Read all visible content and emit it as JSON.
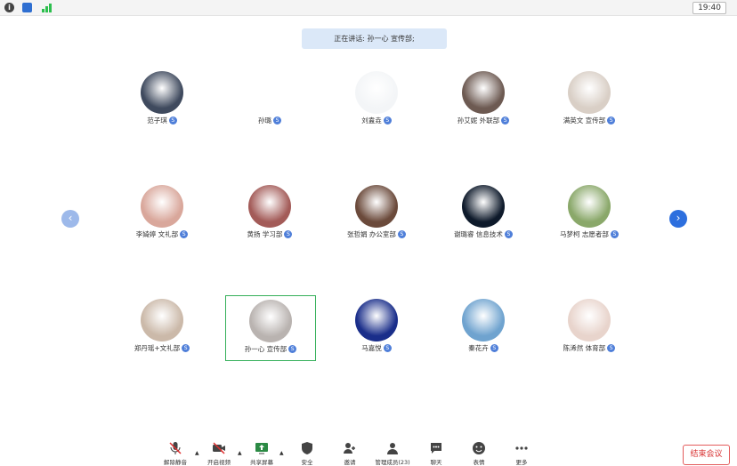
{
  "status_bar": {
    "time": "19:40"
  },
  "speaker_banner": {
    "label": "正在讲话: 孙一心 宣传部;"
  },
  "participants": [
    {
      "name": "范子琪",
      "badge": "S",
      "active": false,
      "avatar_color": "#3f4a5e"
    },
    {
      "name": "孙璐",
      "badge": "S",
      "active": false,
      "avatar_color": "#ffffff"
    },
    {
      "name": "刘盍垚",
      "badge": "S",
      "active": false,
      "avatar_color": "#f3f5f7"
    },
    {
      "name": "孙艾妮 外联部",
      "badge": "S",
      "active": false,
      "avatar_color": "#6d5a52"
    },
    {
      "name": "满英文 宣传部",
      "badge": "S",
      "active": false,
      "avatar_color": "#d9cfc6"
    },
    {
      "name": "李婍婷 文礼部",
      "badge": "S",
      "active": false,
      "avatar_color": "#d9a79b"
    },
    {
      "name": "黄扬 学习部",
      "badge": "S",
      "active": false,
      "avatar_color": "#a35b58"
    },
    {
      "name": "张哲娟 办公室部",
      "badge": "S",
      "active": false,
      "avatar_color": "#6b4a3b"
    },
    {
      "name": "谢璐睿 信息技术",
      "badge": "S",
      "active": false,
      "avatar_color": "#0e1a2b"
    },
    {
      "name": "马梦柯 志愿者部",
      "badge": "S",
      "active": false,
      "avatar_color": "#8aa86a"
    },
    {
      "name": "郑丹瑶+文礼部",
      "badge": "S",
      "active": false,
      "avatar_color": "#cbb9a9"
    },
    {
      "name": "孙一心 宣传部",
      "badge": "S",
      "active": true,
      "avatar_color": "#b9b3b0"
    },
    {
      "name": "马嘉悦",
      "badge": "S",
      "active": false,
      "avatar_color": "#1a2e8a"
    },
    {
      "name": "秦花卉",
      "badge": "S",
      "active": false,
      "avatar_color": "#6fa3cf"
    },
    {
      "name": "陈浠然 体育部",
      "badge": "S",
      "active": false,
      "avatar_color": "#e8d4cc"
    }
  ],
  "toolbar": {
    "items": [
      {
        "label": "解除静音",
        "icon": "mic-muted-icon"
      },
      {
        "label": "开启视频",
        "icon": "video-off-icon"
      },
      {
        "label": "共享屏幕",
        "icon": "share-screen-icon"
      },
      {
        "label": "安全",
        "icon": "shield-icon"
      },
      {
        "label": "邀请",
        "icon": "invite-icon"
      },
      {
        "label": "管理成员(23)",
        "icon": "members-icon"
      },
      {
        "label": "聊天",
        "icon": "chat-icon"
      },
      {
        "label": "表情",
        "icon": "emoji-icon"
      },
      {
        "label": "更多",
        "icon": "more-icon"
      }
    ],
    "end_meeting": "结束会议"
  },
  "nav": {
    "prev_icon": "chevron-left-icon",
    "next_icon": "chevron-right-icon"
  },
  "colors": {
    "accent": "#2d6fde",
    "active_border": "#35b05a",
    "danger": "#d83131",
    "badge": "#4f7fd9"
  }
}
